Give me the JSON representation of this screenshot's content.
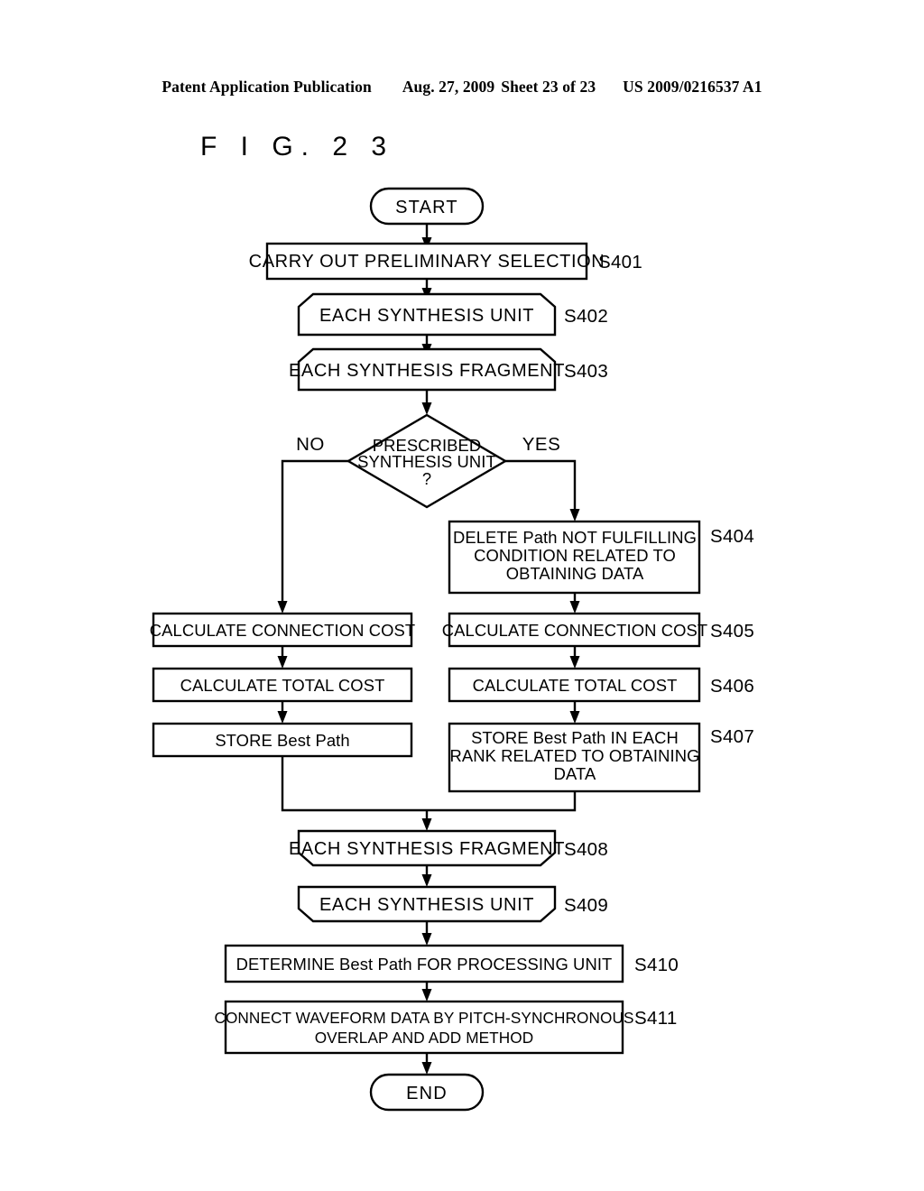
{
  "header": {
    "publication": "Patent Application Publication",
    "date": "Aug. 27, 2009",
    "sheet": "Sheet 23 of 23",
    "patent_number": "US 2009/0216537 A1"
  },
  "figure": {
    "title": "F I G.  2 3"
  },
  "flowchart": {
    "branch_labels": {
      "no": "NO",
      "yes": "YES"
    },
    "nodes": [
      {
        "id": "start",
        "type": "terminator",
        "lines": [
          "START"
        ],
        "step": ""
      },
      {
        "id": "s401",
        "type": "process",
        "lines": [
          "CARRY OUT PRELIMINARY SELECTION"
        ],
        "step": "S401"
      },
      {
        "id": "s402",
        "type": "loop-start",
        "lines": [
          "EACH SYNTHESIS UNIT"
        ],
        "step": "S402"
      },
      {
        "id": "s403",
        "type": "loop-start",
        "lines": [
          "EACH SYNTHESIS FRAGMENT"
        ],
        "step": "S403"
      },
      {
        "id": "decision",
        "type": "decision",
        "lines": [
          "PRESCRIBED",
          "SYNTHESIS UNIT",
          "?"
        ],
        "step": ""
      },
      {
        "id": "s404",
        "type": "process",
        "lines": [
          "DELETE Path NOT FULFILLING",
          "CONDITION RELATED TO",
          "OBTAINING DATA"
        ],
        "step": "S404"
      },
      {
        "id": "left_conn_cost",
        "type": "process",
        "lines": [
          "CALCULATE CONNECTION COST"
        ],
        "step": ""
      },
      {
        "id": "left_total_cost",
        "type": "process",
        "lines": [
          "CALCULATE TOTAL COST"
        ],
        "step": ""
      },
      {
        "id": "left_store",
        "type": "process",
        "lines": [
          "STORE Best Path"
        ],
        "step": ""
      },
      {
        "id": "s405",
        "type": "process",
        "lines": [
          "CALCULATE CONNECTION COST"
        ],
        "step": "S405"
      },
      {
        "id": "s406",
        "type": "process",
        "lines": [
          "CALCULATE TOTAL COST"
        ],
        "step": "S406"
      },
      {
        "id": "s407",
        "type": "process",
        "lines": [
          "STORE Best Path IN EACH",
          "RANK RELATED TO OBTAINING",
          "DATA"
        ],
        "step": "S407"
      },
      {
        "id": "s408",
        "type": "loop-end",
        "lines": [
          "EACH SYNTHESIS FRAGMENT"
        ],
        "step": "S408"
      },
      {
        "id": "s409",
        "type": "loop-end",
        "lines": [
          "EACH SYNTHESIS UNIT"
        ],
        "step": "S409"
      },
      {
        "id": "s410",
        "type": "process",
        "lines": [
          "DETERMINE Best Path FOR PROCESSING UNIT"
        ],
        "step": "S410"
      },
      {
        "id": "s411",
        "type": "process",
        "lines": [
          "CONNECT WAVEFORM DATA BY PITCH-SYNCHRONOUS",
          "OVERLAP AND ADD METHOD"
        ],
        "step": "S411"
      },
      {
        "id": "end",
        "type": "terminator",
        "lines": [
          "END"
        ],
        "step": ""
      }
    ]
  }
}
